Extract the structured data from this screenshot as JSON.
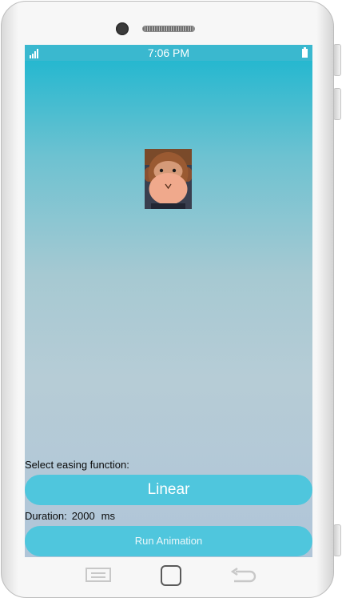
{
  "status_bar": {
    "time": "7:06 PM"
  },
  "main": {
    "image_description": "monkey-image",
    "easing_label": "Select easing function:",
    "easing_selected": "Linear",
    "duration_label": "Duration:",
    "duration_value": "2000",
    "duration_unit": "ms",
    "run_button_label": "Run Animation"
  },
  "colors": {
    "status_bar": "#3ab8cf",
    "button_bg": "#4fc6dd",
    "screen_top": "#1ab6cf",
    "screen_bottom": "#b0c5d8"
  },
  "icons": {
    "signal": "signal-icon",
    "battery": "battery-icon",
    "menu": "menu-icon",
    "home": "home-icon",
    "back": "back-icon"
  }
}
